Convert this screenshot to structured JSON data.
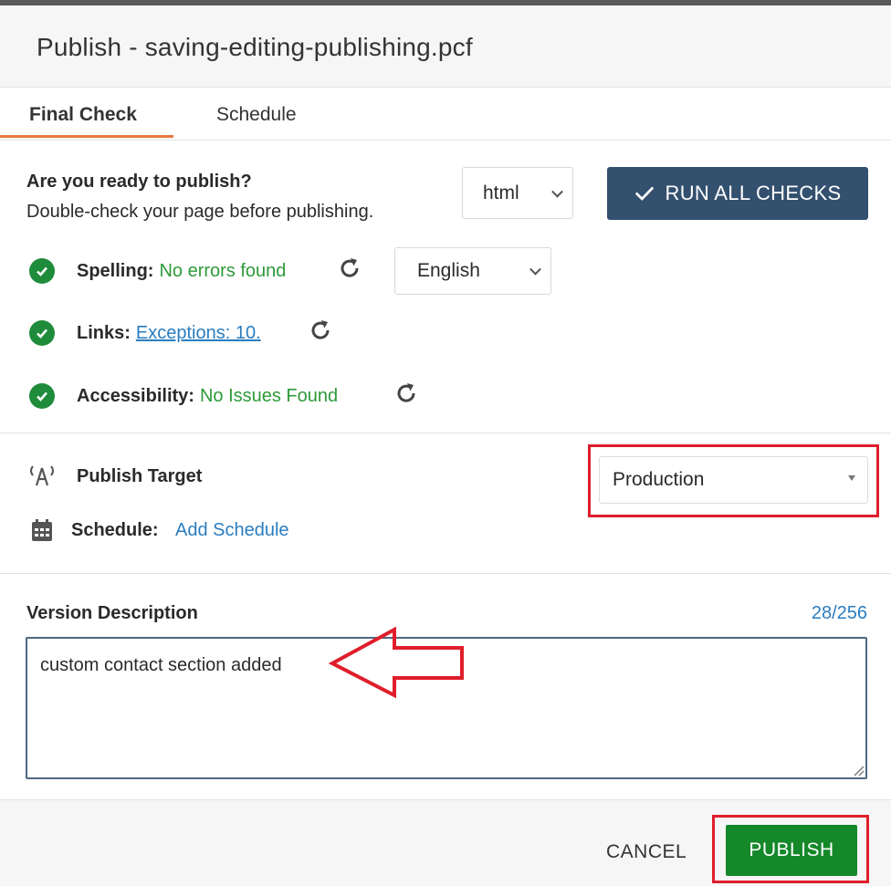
{
  "dialog": {
    "title": "Publish - saving-editing-publishing.pcf"
  },
  "tabs": [
    {
      "label": "Final Check",
      "active": true
    },
    {
      "label": "Schedule",
      "active": false
    }
  ],
  "final_check": {
    "heading": "Are you ready to publish?",
    "subheading": "Double-check your page before publishing.",
    "format_select": {
      "value": "html"
    },
    "run_checks_label": "RUN ALL CHECKS",
    "checks": {
      "spelling": {
        "label": "Spelling:",
        "result": "No errors found",
        "status": "pass"
      },
      "links": {
        "label": "Links:",
        "result": "Exceptions: 10.",
        "status": "pass"
      },
      "accessibility": {
        "label": "Accessibility:",
        "result": "No Issues Found",
        "status": "pass"
      }
    },
    "language_select": {
      "value": "English"
    }
  },
  "publish_target": {
    "label": "Publish Target",
    "value": "Production"
  },
  "schedule": {
    "label": "Schedule:",
    "link": "Add Schedule"
  },
  "version_description": {
    "label": "Version Description",
    "counter": "28/256",
    "value": "custom contact section added"
  },
  "footer": {
    "cancel_label": "CANCEL",
    "publish_label": "PUBLISH"
  },
  "colors": {
    "accent_tab": "#e87a3c",
    "run_button": "#34506f",
    "pass_green": "#1f8c3b",
    "link_blue": "#2a7dc0",
    "publish_green": "#15882a",
    "annotation_red": "#e01e2b"
  },
  "icons": {
    "check": "check-circle-icon",
    "refresh": "refresh-icon",
    "target": "broadcast-icon",
    "calendar": "calendar-icon"
  }
}
